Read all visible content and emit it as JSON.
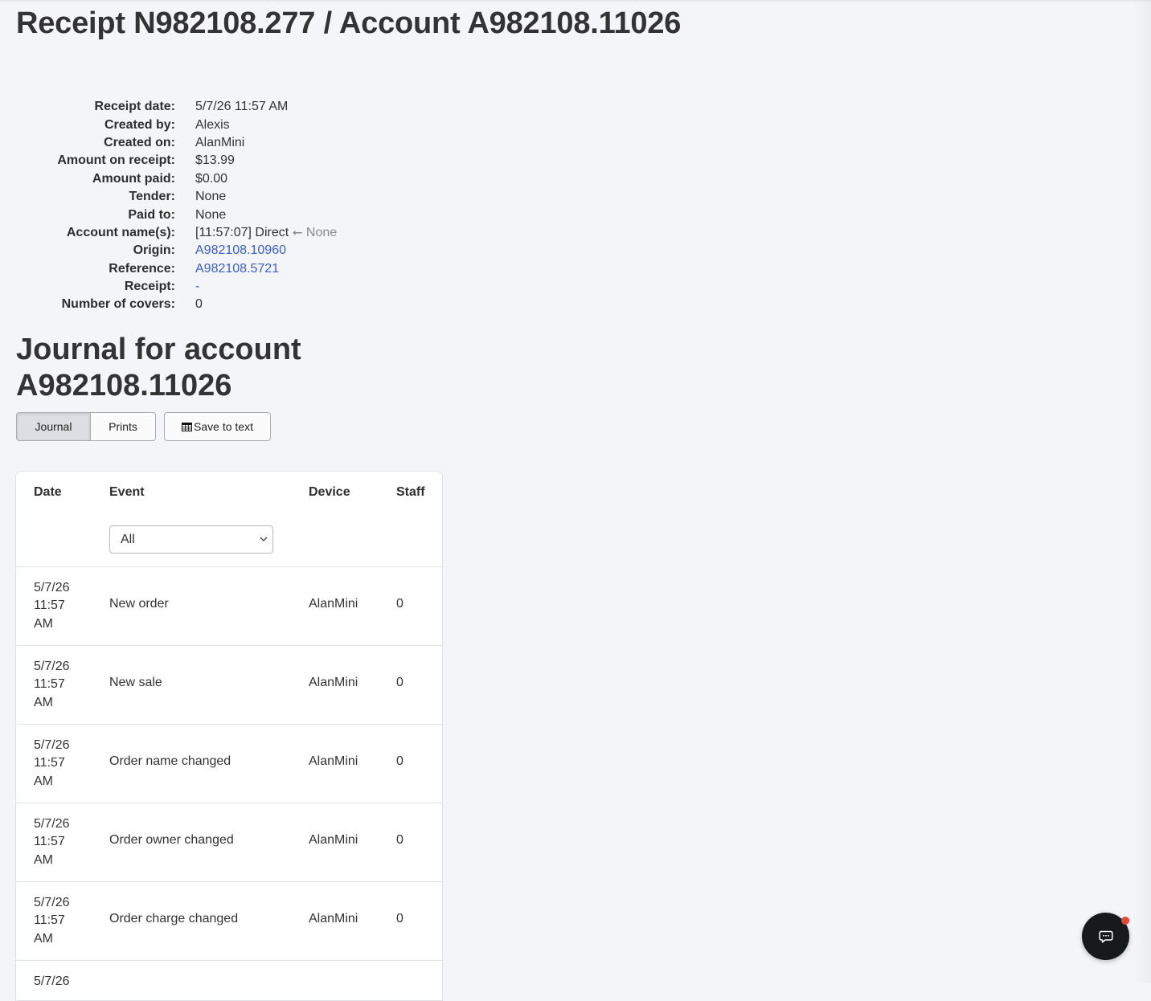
{
  "header": {
    "title": "Receipt N982108.277 / Account A982108.11026"
  },
  "details": [
    {
      "label": "Receipt date:",
      "value": "5/7/26 11:57 AM"
    },
    {
      "label": "Created by:",
      "value": "Alexis"
    },
    {
      "label": "Created on:",
      "value": "AlanMini"
    },
    {
      "label": "Amount on receipt:",
      "value": "$13.99"
    },
    {
      "label": "Amount paid:",
      "value": "$0.00"
    },
    {
      "label": "Tender:",
      "value": "None"
    },
    {
      "label": "Paid to:",
      "value": "None"
    },
    {
      "label": "Account name(s):",
      "value": "[11:57:07] Direct",
      "value_suffix": "⭠ None"
    },
    {
      "label": "Origin:",
      "value": "A982108.10960",
      "link": true
    },
    {
      "label": "Reference:",
      "value": "A982108.5721",
      "link": true
    },
    {
      "label": "Receipt:",
      "value": "-",
      "link": true
    },
    {
      "label": "Number of covers:",
      "value": "0"
    }
  ],
  "journal": {
    "title": "Journal for account A982108.11026",
    "tabs": {
      "journal": "Journal",
      "prints": "Prints"
    },
    "save_label": "Save to text",
    "columns": {
      "date": "Date",
      "event": "Event",
      "device": "Device",
      "staff": "Staff"
    },
    "event_filter": {
      "selected": "All"
    },
    "rows": [
      {
        "date": [
          "5/7/26",
          "11:57",
          "AM"
        ],
        "event": "New order",
        "device": "AlanMini",
        "staff": "0"
      },
      {
        "date": [
          "5/7/26",
          "11:57",
          "AM"
        ],
        "event": "New sale",
        "device": "AlanMini",
        "staff": "0"
      },
      {
        "date": [
          "5/7/26",
          "11:57",
          "AM"
        ],
        "event": "Order name changed",
        "device": "AlanMini",
        "staff": "0"
      },
      {
        "date": [
          "5/7/26",
          "11:57",
          "AM"
        ],
        "event": "Order owner changed",
        "device": "AlanMini",
        "staff": "0"
      },
      {
        "date": [
          "5/7/26",
          "11:57",
          "AM"
        ],
        "event": "Order charge changed",
        "device": "AlanMini",
        "staff": "0"
      },
      {
        "date": [
          "5/7/26",
          "",
          ""
        ],
        "event": "",
        "device": "",
        "staff": ""
      }
    ]
  },
  "chat": {
    "icon": "chat-bubble-icon",
    "notification_color": "#e5463b"
  },
  "colors": {
    "link": "#3a5fcd",
    "background": "#f3f5f9"
  }
}
